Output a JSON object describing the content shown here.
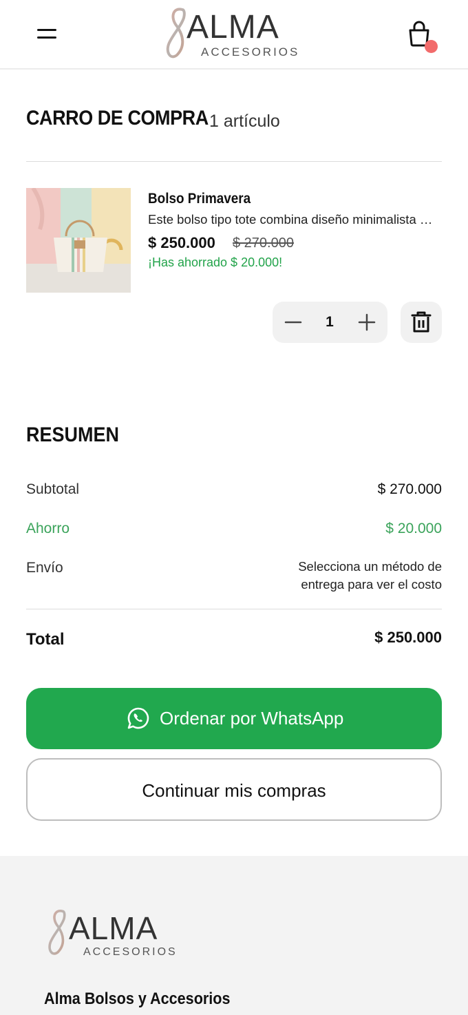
{
  "header": {
    "logo_word": "ALMA",
    "logo_sub": "ACCESORIOS",
    "menu_icon": "hamburger-menu-icon",
    "cart_icon": "shopping-bag-icon",
    "badge_color": "#f26b6b"
  },
  "cart": {
    "title": "CARRO DE COMPRA",
    "count_label": "1 artículo",
    "items": [
      {
        "name": "Bolso Primavera",
        "description": "Este bolso tipo tote combina diseño minimalista y elegante",
        "price": "$ 250.000",
        "old_price": "$ 270.000",
        "savings": "¡Has ahorrado $ 20.000!",
        "quantity": "1"
      }
    ]
  },
  "summary": {
    "title": "RESUMEN",
    "subtotal_label": "Subtotal",
    "subtotal_value": "$ 270.000",
    "savings_label": "Ahorro",
    "savings_value": "$ 20.000",
    "shipping_label": "Envío",
    "shipping_note": "Selecciona un método de entrega para ver el costo",
    "total_label": "Total",
    "total_value": "$ 250.000"
  },
  "actions": {
    "whatsapp_label": "Ordenar por WhatsApp",
    "continue_label": "Continuar mis compras",
    "whatsapp_color": "#21a84e"
  },
  "footer": {
    "logo_word": "ALMA",
    "logo_sub": "ACCESORIOS",
    "brand_name": "Alma Bolsos y Accesorios"
  },
  "colors": {
    "accent_green": "#22a34a",
    "text": "#111111"
  }
}
